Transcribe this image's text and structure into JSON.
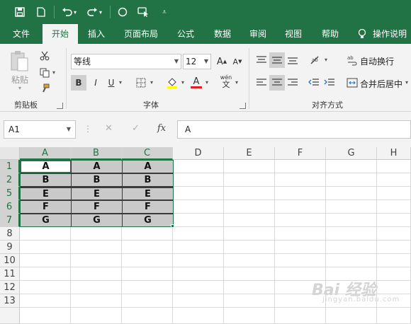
{
  "qat": {
    "icons": [
      "save-icon",
      "new-file-icon",
      "undo-icon",
      "redo-icon",
      "circle-shape-icon",
      "touch-mode-icon",
      "customize-qat-icon"
    ]
  },
  "tabs": [
    {
      "label": "文件"
    },
    {
      "label": "开始"
    },
    {
      "label": "插入"
    },
    {
      "label": "页面布局"
    },
    {
      "label": "公式"
    },
    {
      "label": "数据"
    },
    {
      "label": "审阅"
    },
    {
      "label": "视图"
    },
    {
      "label": "帮助"
    },
    {
      "label": "操作说明"
    }
  ],
  "ribbon": {
    "clipboard": {
      "paste_label": "粘贴",
      "group_label": "剪贴板"
    },
    "font": {
      "font_name": "等线",
      "font_size": "12",
      "bold": "B",
      "italic": "I",
      "underline": "U",
      "font_color_glyph": "A",
      "grow_glyph": "A",
      "shrink_glyph": "A",
      "phonetic_top": "wén",
      "phonetic_bottom": "文",
      "group_label": "字体"
    },
    "alignment": {
      "wrap_text": "自动换行",
      "merge_center": "合并后居中",
      "group_label": "对齐方式"
    }
  },
  "formula_bar": {
    "name_box": "A1",
    "fx": "fx",
    "content": "A"
  },
  "sheet": {
    "columns": [
      "A",
      "B",
      "C",
      "D",
      "E",
      "F",
      "G",
      "H"
    ],
    "rows": [
      "1",
      "2",
      "5",
      "6",
      "7",
      "8",
      "9",
      "10",
      "11",
      "12",
      "13"
    ],
    "data": [
      [
        "A",
        "A",
        "A"
      ],
      [
        "B",
        "B",
        "B"
      ],
      [
        "E",
        "E",
        "E"
      ],
      [
        "F",
        "F",
        "F"
      ],
      [
        "G",
        "G",
        "G"
      ]
    ]
  },
  "watermark": {
    "main": "Bai 经验",
    "sub": "jingyan.baidu.com"
  },
  "colors": {
    "accent": "#217346",
    "selection_fill": "#c9c9c9"
  }
}
